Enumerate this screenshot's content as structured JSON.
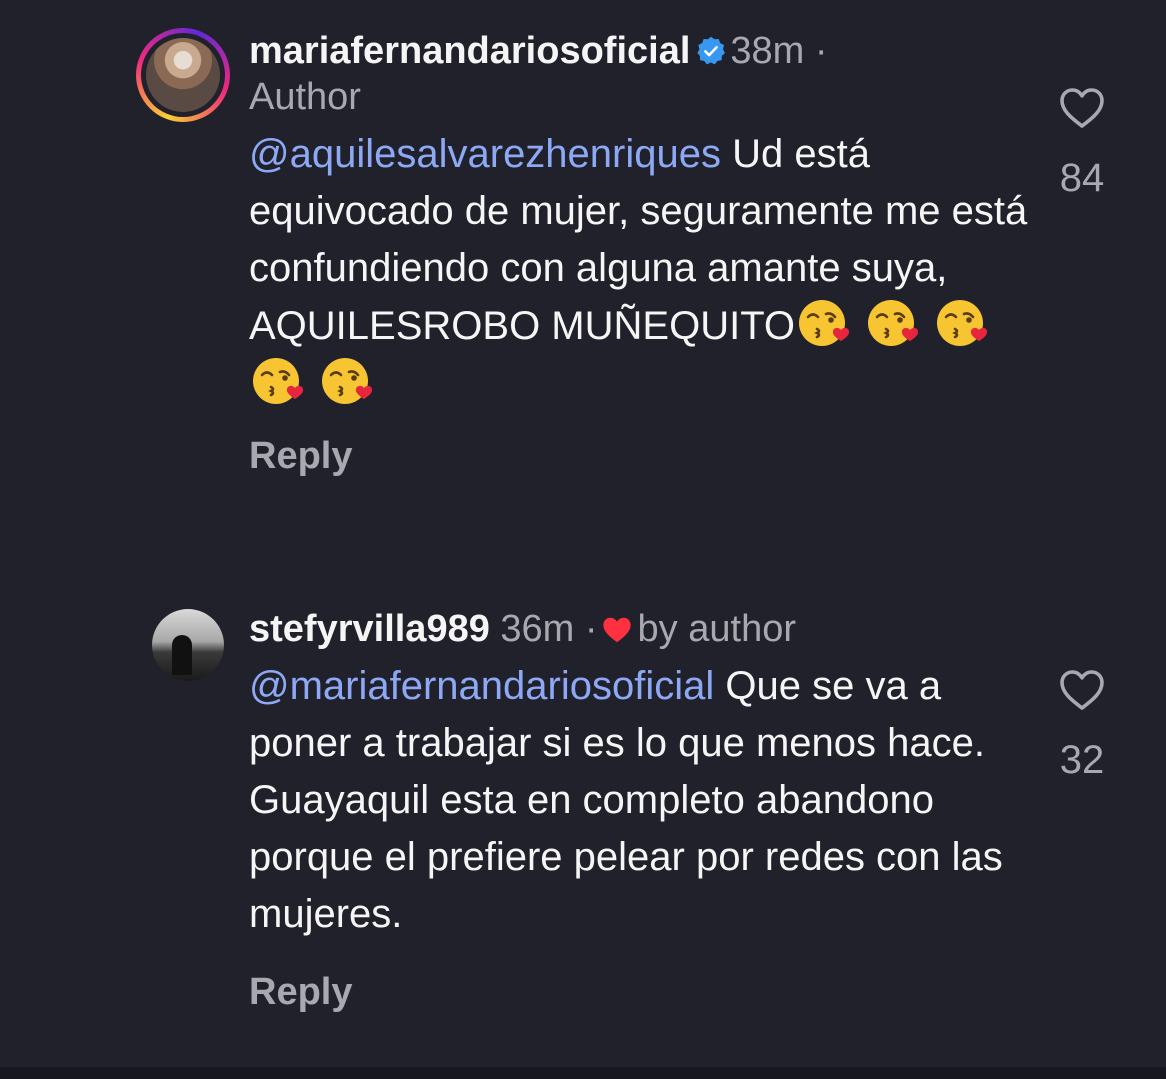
{
  "comments": [
    {
      "username": "mariafernandariosoficial",
      "verified": true,
      "time": "38m",
      "separator": "·",
      "sublabel": "Author",
      "mention": "@aquilesalvarezhenriques",
      "text": " Ud está equivocado de mujer, seguramente me está confundiendo con alguna amante suya, AQUILESROBO MUÑEQUITO",
      "emojis": [
        "face-blowing-kiss-emoji",
        "face-blowing-kiss-emoji",
        "face-blowing-kiss-emoji",
        "face-blowing-kiss-emoji",
        "face-blowing-kiss-emoji"
      ],
      "reply_label": "Reply",
      "likes": "84"
    },
    {
      "username": "stefyrvilla989",
      "time": "36m",
      "separator": "·",
      "liked_by": "by author",
      "mention": "@mariafernandariosoficial",
      "text": " Que se va a poner a trabajar si es lo que menos hace. Guayaquil esta en completo abandono porque el prefiere pelear por redes con las mujeres.",
      "reply_label": "Reply",
      "likes": "32"
    }
  ],
  "colors": {
    "background": "#21212b",
    "mention": "#8da8f5",
    "muted": "#a8a8b0",
    "verified": "#3897f0",
    "heart": "#ff3040"
  }
}
